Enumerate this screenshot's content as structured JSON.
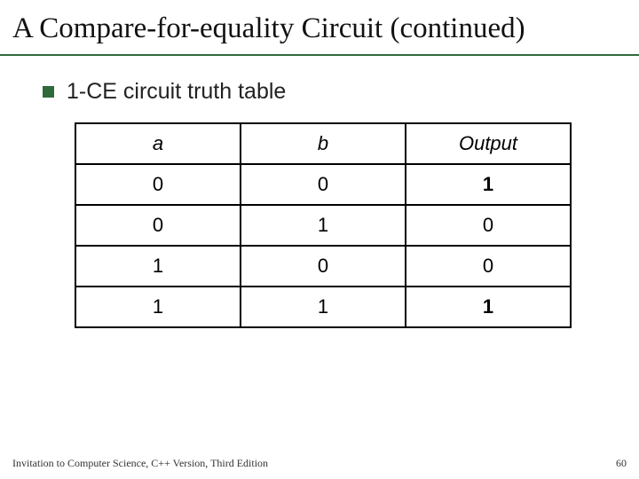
{
  "title": "A Compare-for-equality Circuit (continued)",
  "bullet": "1-CE circuit truth table",
  "headers": {
    "c0": "a",
    "c1": "b",
    "c2": "Output"
  },
  "rows": [
    {
      "a": "0",
      "b": "0",
      "out": "1",
      "bold": true
    },
    {
      "a": "0",
      "b": "1",
      "out": "0",
      "bold": false
    },
    {
      "a": "1",
      "b": "0",
      "out": "0",
      "bold": false
    },
    {
      "a": "1",
      "b": "1",
      "out": "1",
      "bold": true
    }
  ],
  "footer": {
    "source": "Invitation to Computer Science, C++ Version, Third Edition",
    "page": "60"
  },
  "chart_data": {
    "type": "table",
    "title": "1-CE circuit truth table",
    "columns": [
      "a",
      "b",
      "Output"
    ],
    "rows": [
      [
        0,
        0,
        1
      ],
      [
        0,
        1,
        0
      ],
      [
        1,
        0,
        0
      ],
      [
        1,
        1,
        1
      ]
    ]
  }
}
